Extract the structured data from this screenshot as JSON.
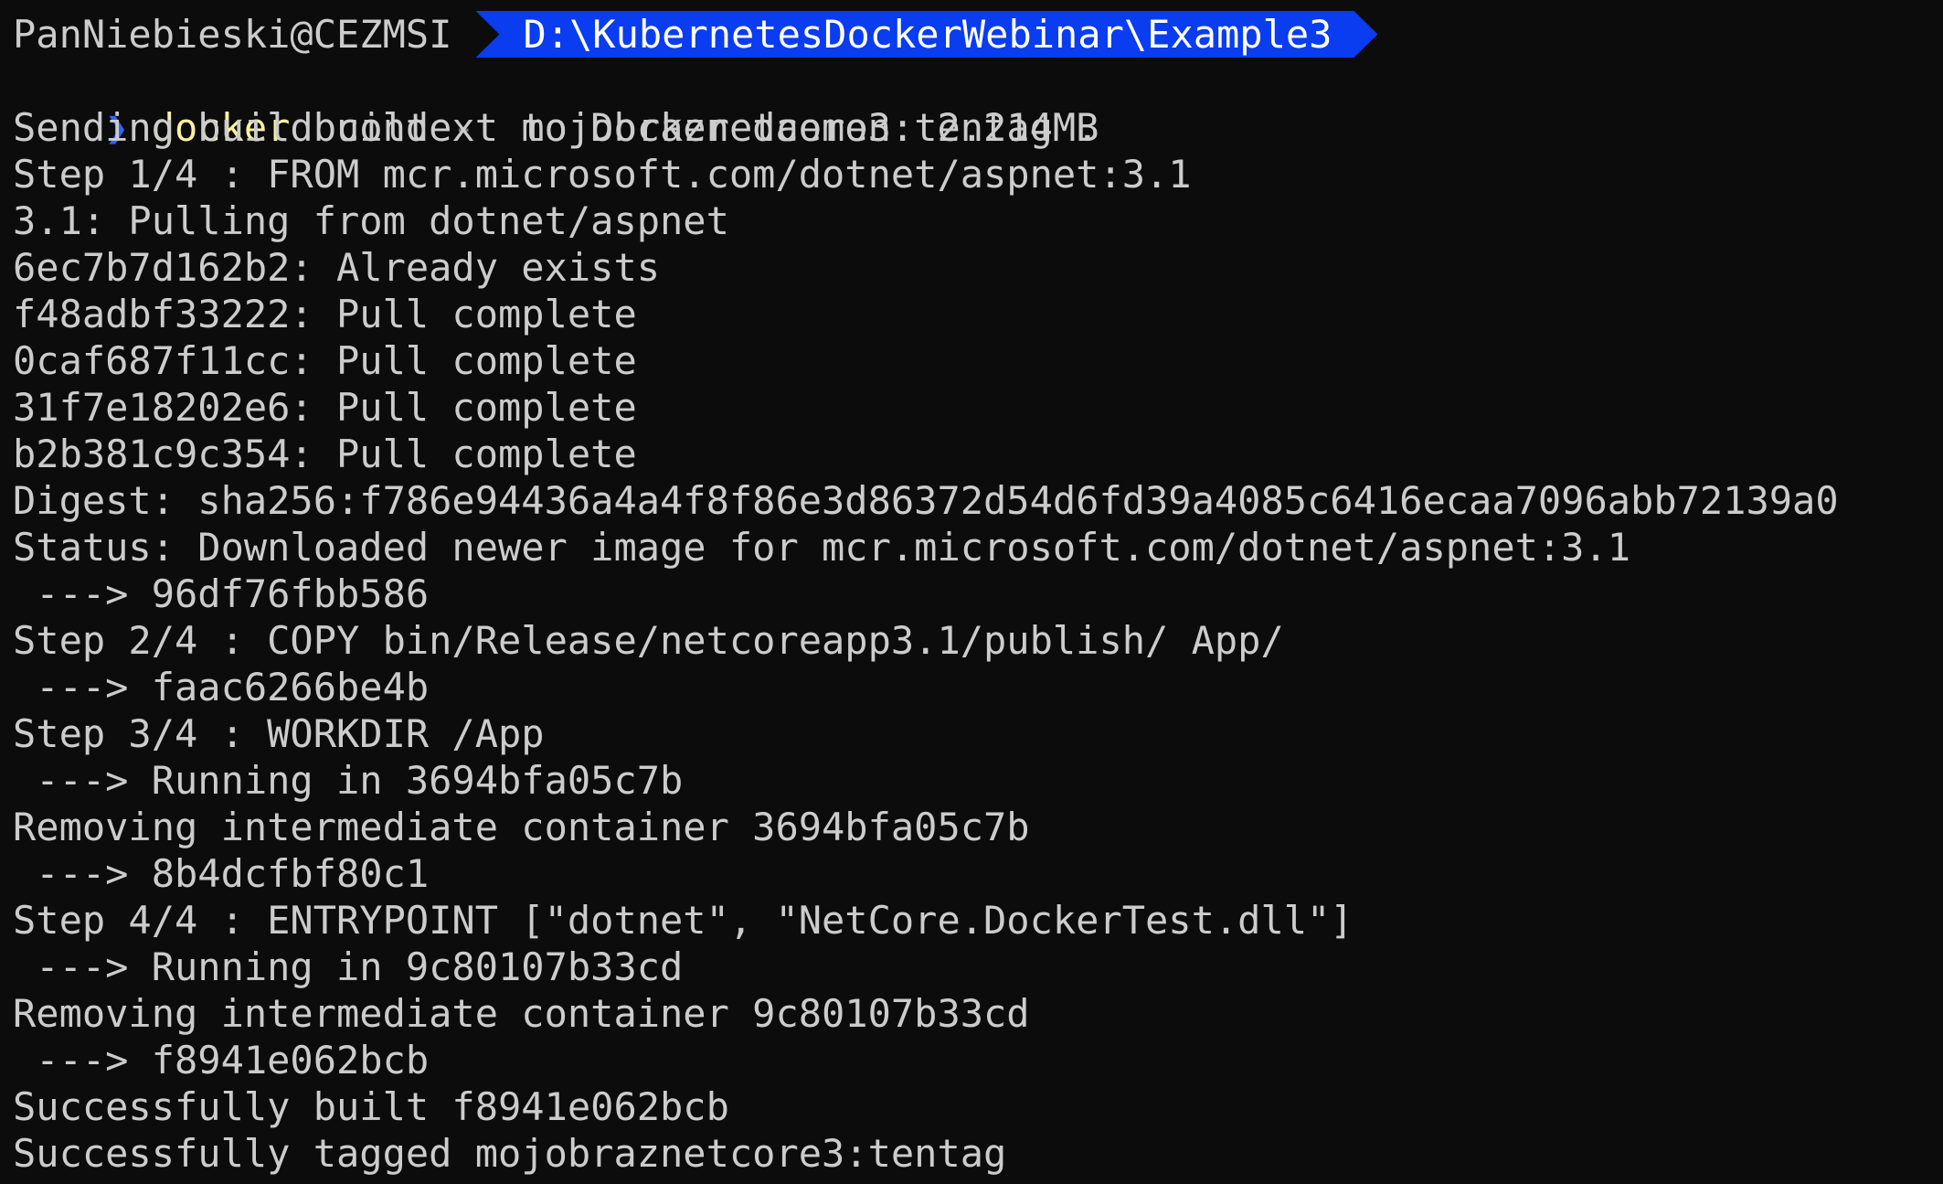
{
  "prompt": {
    "user_host": "PanNiebieski@CEZMSI",
    "path": "D:\\KubernetesDockerWebinar\\Example3",
    "chevron": "❯",
    "command": {
      "program": "docker",
      "arg1": "build",
      "flag": "-t",
      "rest": "mojobraznetcore3:tentag ."
    }
  },
  "colors": {
    "background": "#0c0c0c",
    "text": "#cccccc",
    "path_segment": "#0a3cf0",
    "chevron": "#2f63ff",
    "program": "#f9f1a5",
    "flag": "#767676"
  },
  "output": [
    "Sending build context to Docker daemon  2.214MB",
    "Step 1/4 : FROM mcr.microsoft.com/dotnet/aspnet:3.1",
    "3.1: Pulling from dotnet/aspnet",
    "6ec7b7d162b2: Already exists",
    "f48adbf33222: Pull complete",
    "0caf687f11cc: Pull complete",
    "31f7e18202e6: Pull complete",
    "b2b381c9c354: Pull complete",
    "Digest: sha256:f786e94436a4a4f8f86e3d86372d54d6fd39a4085c6416ecaa7096abb72139a0",
    "Status: Downloaded newer image for mcr.microsoft.com/dotnet/aspnet:3.1",
    " ---> 96df76fbb586",
    "Step 2/4 : COPY bin/Release/netcoreapp3.1/publish/ App/",
    " ---> faac6266be4b",
    "Step 3/4 : WORKDIR /App",
    " ---> Running in 3694bfa05c7b",
    "Removing intermediate container 3694bfa05c7b",
    " ---> 8b4dcfbf80c1",
    "Step 4/4 : ENTRYPOINT [\"dotnet\", \"NetCore.DockerTest.dll\"]",
    " ---> Running in 9c80107b33cd",
    "Removing intermediate container 9c80107b33cd",
    " ---> f8941e062bcb",
    "Successfully built f8941e062bcb",
    "Successfully tagged mojobraznetcore3:tentag"
  ]
}
